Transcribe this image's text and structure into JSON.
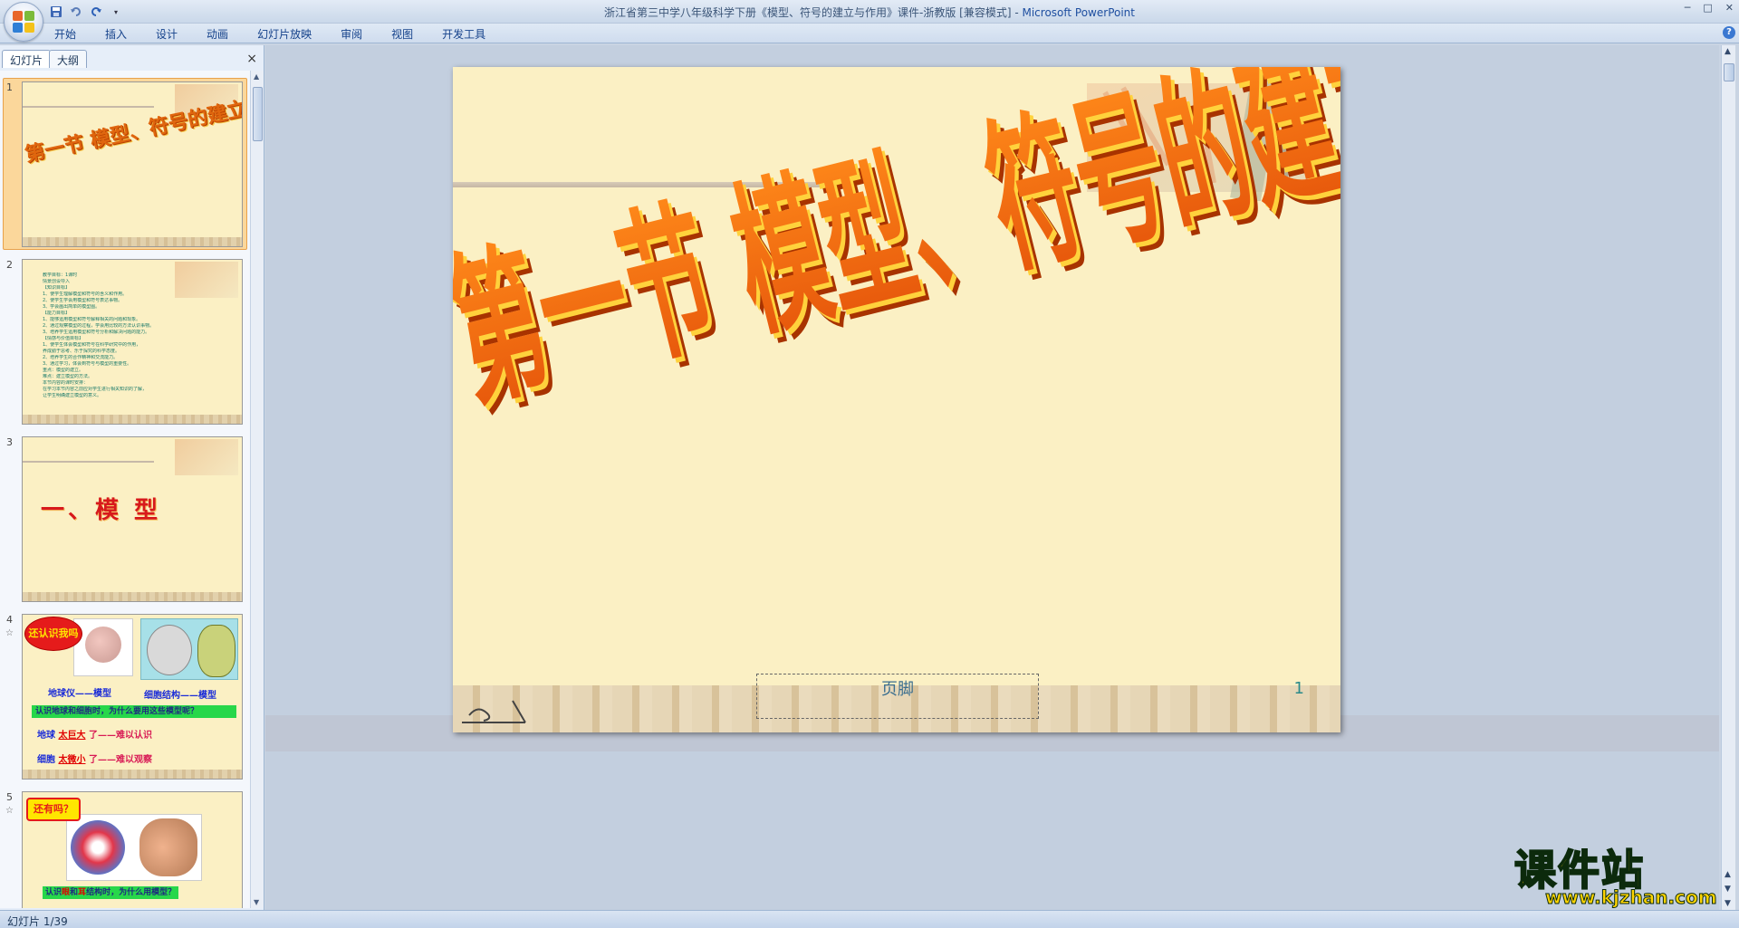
{
  "window": {
    "title": "浙江省第三中学八年级科学下册《模型、符号的建立与作用》课件-浙教版 [兼容模式] - ",
    "app_name": "Microsoft PowerPoint",
    "controls": [
      "─",
      "□",
      "✕"
    ]
  },
  "ribbon": {
    "tabs": [
      "开始",
      "插入",
      "设计",
      "动画",
      "幻灯片放映",
      "审阅",
      "视图",
      "开发工具"
    ],
    "help": "?"
  },
  "left_panel": {
    "tabs": [
      "幻灯片",
      "大纲"
    ],
    "close": "×",
    "thumbnails": [
      {
        "num": "1",
        "title": "第一节 模型、符号的建立与作用"
      },
      {
        "num": "2",
        "lines": [
          "教学目标：1课时",
          "情景创设导入",
          "【知识目标】",
          "1、使学生理解模型和符号的含义和作用。",
          "2、使学生学会用模型和符号表达事物。",
          "3、学会画出简单的模型图。",
          "【能力目标】",
          "1、能够运用模型和符号解释相关的问题和现象。",
          "2、通过观察模型的过程，学会用比较的方法认识事物。",
          "3、培养学生运用模型和符号分析和解决问题的能力。",
          "【情感与价值目标】",
          "1、使学生体会模型和符号在科学研究中的作用，",
          "养成勤于思考、乐于探究的科学态度。",
          "2、培养学生的合作精神和交流能力。",
          "3、通过学习，体会到符号与模型的重要性。",
          "重点：模型的建立。",
          "难点：建立模型的方法。",
          "本节内容的课时安排：",
          "在学习本节内容之前应对学生进行相关知识的了解，",
          "让学生明确建立模型的意义。"
        ]
      },
      {
        "num": "3",
        "title": "一、模 型"
      },
      {
        "num": "4",
        "badge": "还认识我吗",
        "label1": "地球仪——模型",
        "label2": "细胞结构——模型",
        "bar": "认识地球和细胞时，为什么要用这些模型呢？",
        "line1_a": "地球",
        "line1_b": "太巨大",
        "line1_c": "了——难以认识",
        "line2_a": "细胞",
        "line2_b": "太微小",
        "line2_c": "了——难以观察"
      },
      {
        "num": "5",
        "badge": "还有吗？",
        "bar_a": "认识",
        "bar_b": "眼",
        "bar_c": "和",
        "bar_d": "耳",
        "bar_e": "结构时，为什么用模型？"
      }
    ]
  },
  "slide": {
    "title": "第一节 模型、符号的建立与作用",
    "footer": "页脚",
    "number": "1"
  },
  "status_bar": {
    "text": "幻灯片 1/39"
  },
  "watermark": {
    "big": "课件站",
    "small": "www.kjzhan.com"
  }
}
